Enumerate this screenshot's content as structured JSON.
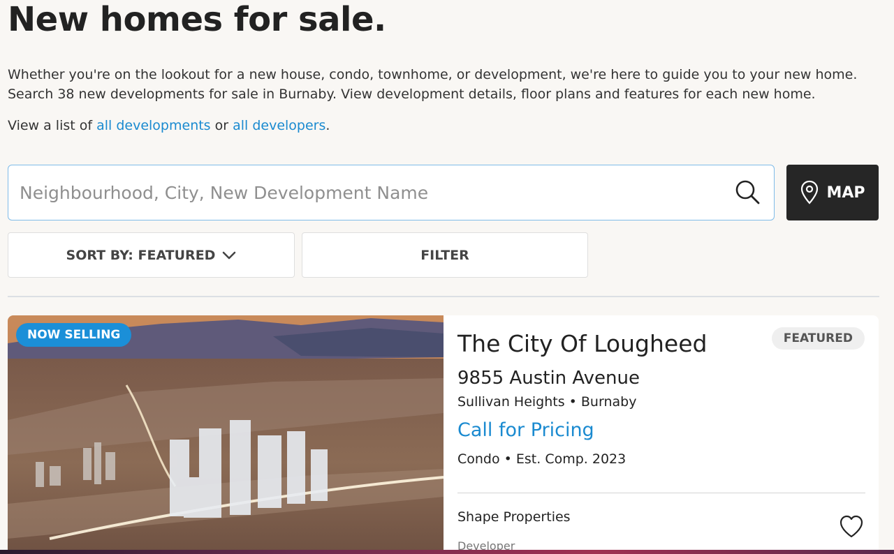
{
  "page": {
    "title": "New homes for sale.",
    "intro_line1": "Whether you're on the lookout for a new house, condo, townhome, or development, we're here to guide you to your new home.",
    "intro_line2": "Search 38 new developments for sale in Burnaby. View development details, floor plans and features for each new home.",
    "links": {
      "prefix": "View a list of ",
      "all_developments": "all developments",
      "middle": " or ",
      "all_developers": "all developers",
      "suffix": "."
    }
  },
  "search": {
    "placeholder": "Neighbourhood, City, New Development Name",
    "value": "",
    "icon": "search-icon"
  },
  "map_button": {
    "label": "MAP",
    "icon": "map-pin-icon"
  },
  "controls": {
    "sort_label": "SORT BY: FEATURED",
    "filter_label": "FILTER"
  },
  "listing": {
    "status_badge": "NOW SELLING",
    "name": "The City Of Lougheed",
    "featured_badge": "FEATURED",
    "address": "9855 Austin Avenue",
    "location": "Sullivan Heights • Burnaby",
    "price": "Call for Pricing",
    "type_completion": "Condo • Est. Comp. 2023",
    "developer_name": "Shape Properties",
    "developer_label": "Developer"
  },
  "colors": {
    "link": "#1a8ad0",
    "badge_blue": "#1b8fd8",
    "map_button_bg": "#262626",
    "page_bg": "#f9f7f4"
  }
}
